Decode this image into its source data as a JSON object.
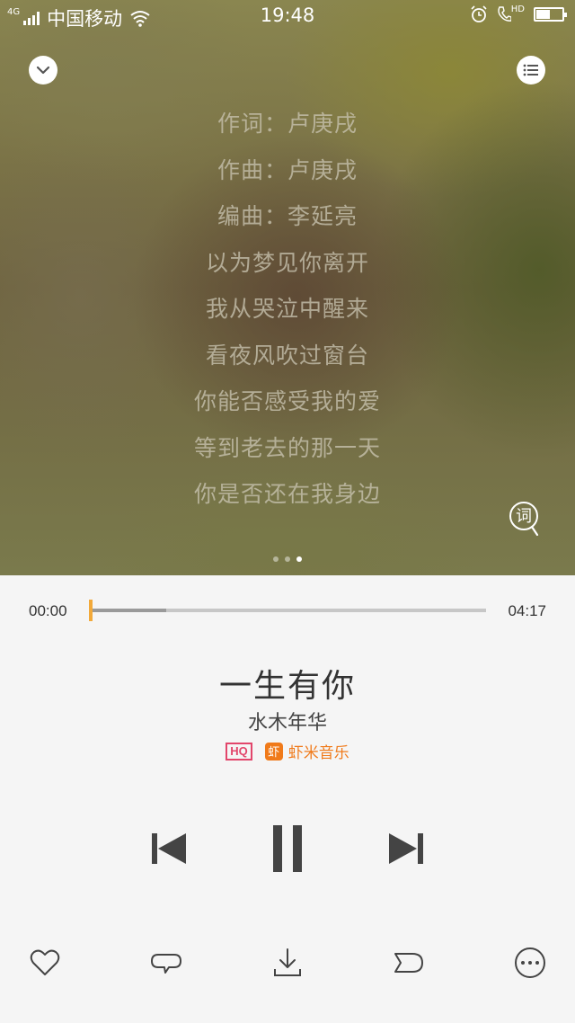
{
  "status_bar": {
    "network_type": "4G",
    "carrier": "中国移动",
    "time": "19:48",
    "call_tag": "HD",
    "battery_level": 0.55
  },
  "lyrics": {
    "lines": [
      "作词：卢庚戌",
      "作曲：卢庚戌",
      "编曲：李延亮",
      "以为梦见你离开",
      "我从哭泣中醒来",
      "看夜风吹过窗台",
      "你能否感受我的爱",
      "等到老去的那一天",
      "你是否还在我身边"
    ],
    "mode_button_label": "词",
    "pages_total": 3,
    "page_active": 3
  },
  "player": {
    "current_time": "00:00",
    "total_time": "04:17",
    "progress_played": 0.0,
    "progress_buffered": 0.19,
    "title": "一生有你",
    "artist": "水木年华",
    "quality_badge": "HQ",
    "source_logo_char": "虾",
    "source_name": "虾米音乐"
  },
  "colors": {
    "accent": "#f2a93a",
    "hq_badge": "#e2466b",
    "source_brand": "#f07a1a",
    "icon": "#444444"
  },
  "icons": {
    "collapse": "chevron-down-icon",
    "playlist": "list-icon",
    "prev": "skip-previous-icon",
    "pause": "pause-icon",
    "next": "skip-next-icon",
    "favorite": "heart-icon",
    "repeat_mode": "loop-icon",
    "download": "download-icon",
    "share": "share-icon",
    "more": "more-icon"
  }
}
